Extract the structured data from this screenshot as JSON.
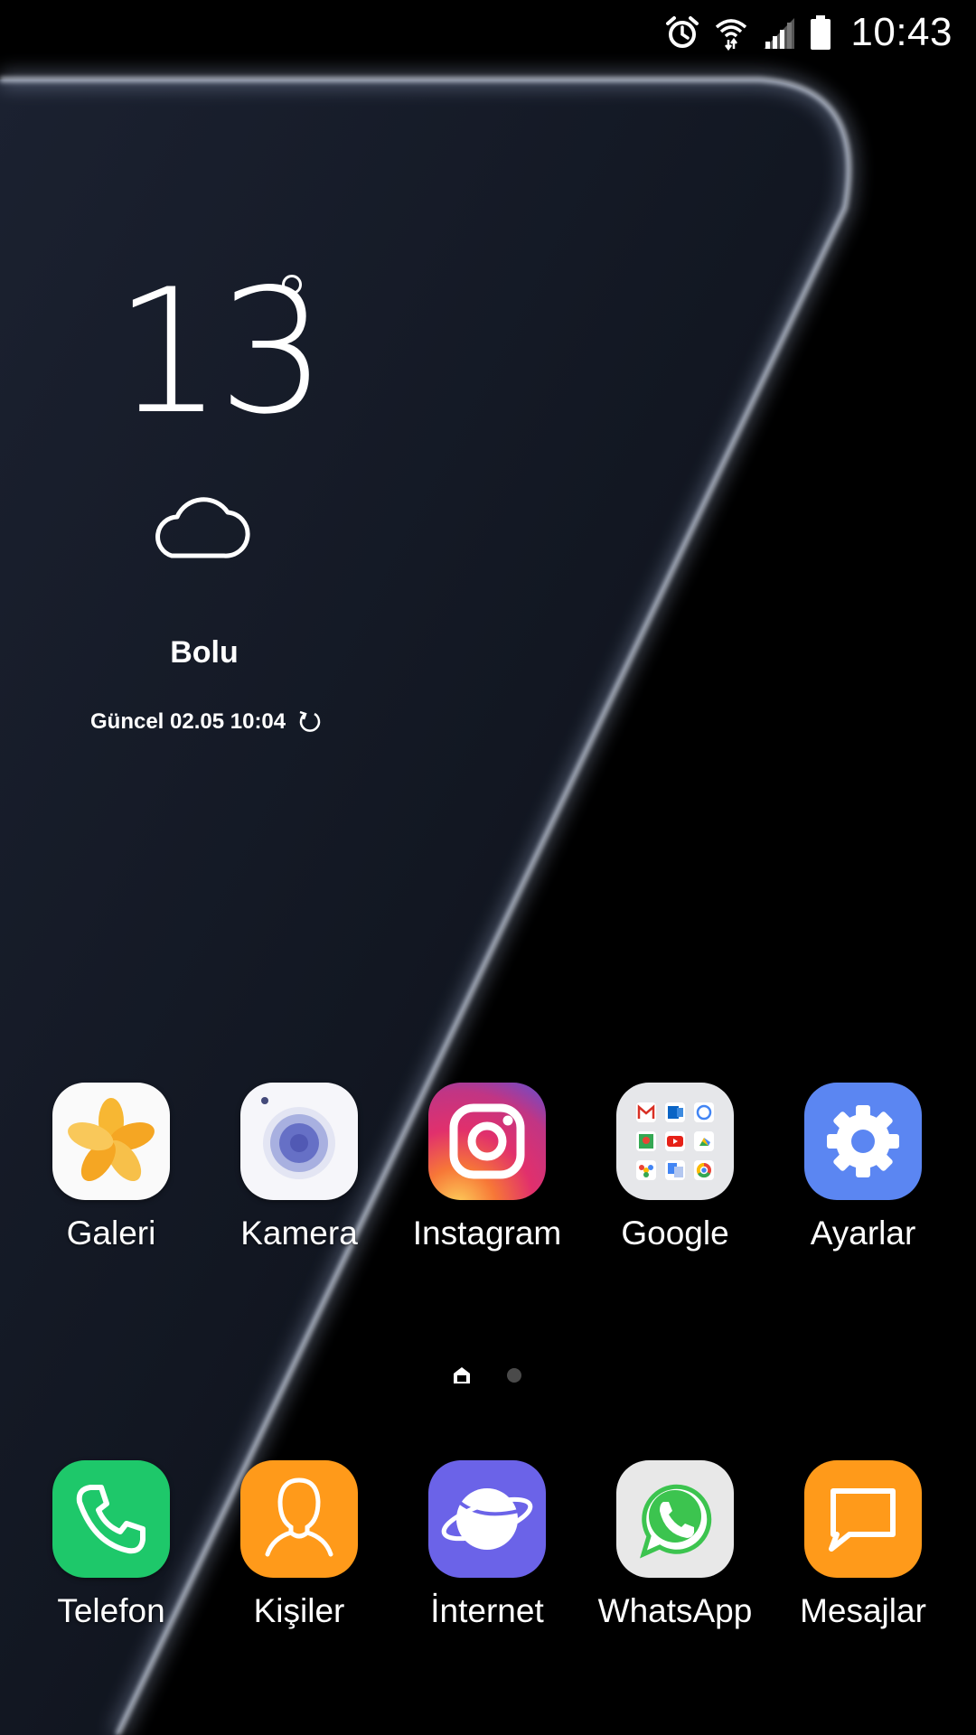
{
  "status_bar": {
    "time": "10:43",
    "icons": [
      "alarm-icon",
      "wifi-icon",
      "signal-icon",
      "battery-icon"
    ]
  },
  "weather": {
    "temperature": "13",
    "condition_icon": "cloud-icon",
    "city": "Bolu",
    "updated": "Güncel 02.05 10:04",
    "refresh_icon": "refresh-icon"
  },
  "apps": [
    {
      "label": "Galeri",
      "icon": "gallery-icon"
    },
    {
      "label": "Kamera",
      "icon": "camera-icon"
    },
    {
      "label": "Instagram",
      "icon": "instagram-icon"
    },
    {
      "label": "Google",
      "icon": "google-folder-icon"
    },
    {
      "label": "Ayarlar",
      "icon": "settings-icon"
    }
  ],
  "page_indicator": {
    "pages": 2,
    "current": 1
  },
  "dock": [
    {
      "label": "Telefon",
      "icon": "phone-icon"
    },
    {
      "label": "Kişiler",
      "icon": "contacts-icon"
    },
    {
      "label": "İnternet",
      "icon": "internet-icon"
    },
    {
      "label": "WhatsApp",
      "icon": "whatsapp-icon"
    },
    {
      "label": "Mesajlar",
      "icon": "messages-icon"
    }
  ],
  "colors": {
    "background": "#000000",
    "wallpaper_panel": "#151a24",
    "wallpaper_edge": "#cfd6e6",
    "telefon": "#1ec86a",
    "kisiler": "#ff9a1a",
    "internet": "#6b63e8",
    "ayarlar": "#5b86f2",
    "mesajlar": "#ff9a1a"
  }
}
